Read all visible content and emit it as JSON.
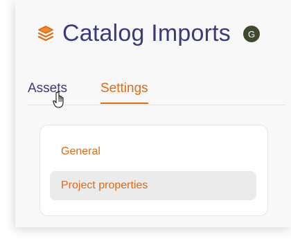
{
  "header": {
    "title": "Catalog Imports",
    "avatar_initial": "G",
    "logo_icon": "stack-layers-icon",
    "accent_color": "#e06b12",
    "title_color": "#3b3a7a",
    "avatar_color": "#3f4a2c"
  },
  "tabs": [
    {
      "label": "Assets",
      "active": false
    },
    {
      "label": "Settings",
      "active": true
    }
  ],
  "settings_menu": {
    "items": [
      {
        "label": "General",
        "selected": false
      },
      {
        "label": "Project properties",
        "selected": true
      }
    ]
  },
  "cursor": {
    "icon": "hand-pointer-icon"
  }
}
